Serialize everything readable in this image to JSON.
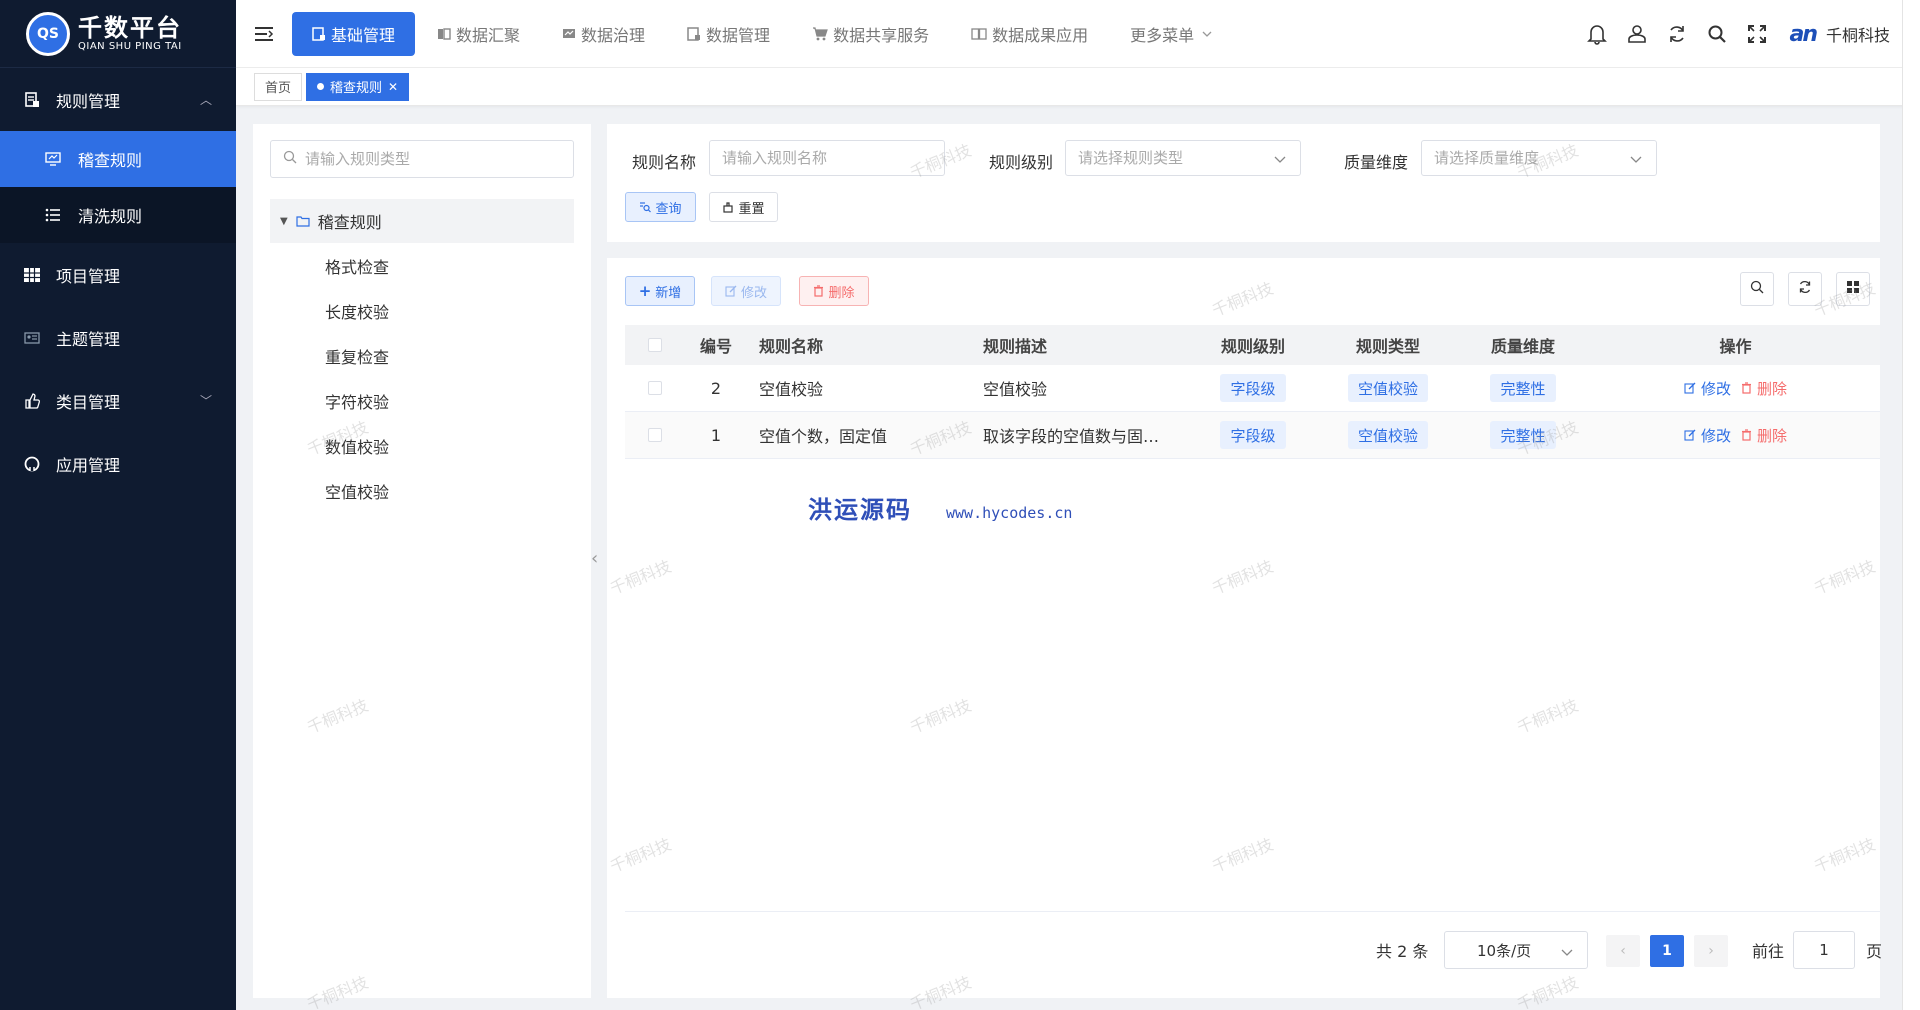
{
  "sidebar": {
    "logo_title": "千数平台",
    "logo_sub": "QIAN SHU PING TAI",
    "logo_mark": "QS",
    "menu": {
      "rules": {
        "label": "规则管理",
        "icon": "document-icon"
      },
      "sub_audit": {
        "label": "稽查规则",
        "icon": "monitor-icon"
      },
      "sub_clean": {
        "label": "清洗规则",
        "icon": "list-icon"
      },
      "project": {
        "label": "项目管理",
        "icon": "grid-icon"
      },
      "theme": {
        "label": "主题管理",
        "icon": "id-card-icon"
      },
      "category": {
        "label": "类目管理",
        "icon": "thumb-icon"
      },
      "app": {
        "label": "应用管理",
        "icon": "github-icon"
      }
    }
  },
  "topnav": {
    "tabs": [
      {
        "label": "基础管理",
        "active": true
      },
      {
        "label": "数据汇聚"
      },
      {
        "label": "数据治理"
      },
      {
        "label": "数据管理"
      },
      {
        "label": "数据共享服务"
      },
      {
        "label": "数据成果应用"
      },
      {
        "label": "更多菜单"
      }
    ],
    "brand_mark": "an",
    "brand_name": "千桐科技"
  },
  "tags": {
    "home": "首页",
    "current": "稽查规则"
  },
  "tree": {
    "search_placeholder": "请输入规则类型",
    "root": "稽查规则",
    "children": [
      "格式检查",
      "长度校验",
      "重复检查",
      "字符校验",
      "数值校验",
      "空值校验"
    ]
  },
  "filters": {
    "name_label": "规则名称",
    "name_placeholder": "请输入规则名称",
    "level_label": "规则级别",
    "level_placeholder": "请选择规则类型",
    "dim_label": "质量维度",
    "dim_placeholder": "请选择质量维度",
    "query_btn": "查询",
    "reset_btn": "重置"
  },
  "toolbar": {
    "add": "新增",
    "edit": "修改",
    "delete": "删除"
  },
  "table": {
    "headers": {
      "no": "编号",
      "name": "规则名称",
      "desc": "规则描述",
      "level": "规则级别",
      "type": "规则类型",
      "dim": "质量维度",
      "op": "操作"
    },
    "rows": [
      {
        "no": "2",
        "name": "空值校验",
        "desc": "空值校验",
        "level": "字段级",
        "type": "空值校验",
        "dim": "完整性",
        "edit": "修改",
        "delete": "删除"
      },
      {
        "no": "1",
        "name": "空值个数，固定值",
        "desc": "取该字段的空值数与固…",
        "level": "字段级",
        "type": "空值校验",
        "dim": "完整性",
        "edit": "修改",
        "delete": "删除"
      }
    ]
  },
  "overlay": {
    "cn": "洪运源码",
    "url": "www.hycodes.cn"
  },
  "pagination": {
    "total": "共 2 条",
    "page_size": "10条/页",
    "current_page": "1",
    "goto_label": "前往",
    "goto_value": "1",
    "page_suffix": "页"
  },
  "watermark_text": "千桐科技",
  "colors": {
    "primary": "#2f6fe4",
    "sidebar_bg": "#0f1b30",
    "danger": "#f56c6c"
  }
}
